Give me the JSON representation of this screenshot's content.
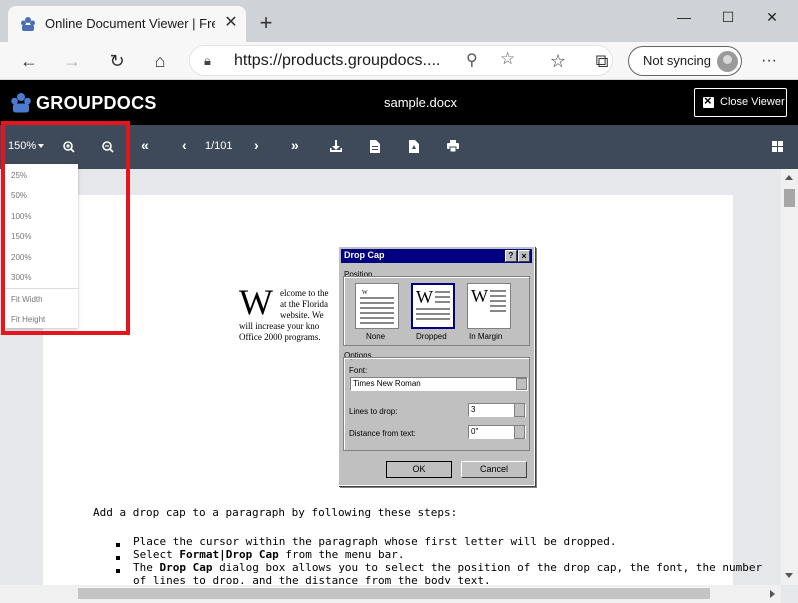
{
  "browser": {
    "tab_title": "Online Document Viewer | Free C",
    "url": "https://products.groupdocs....",
    "sync_label": "Not syncing"
  },
  "app": {
    "logo_text": "GROUPDOCS",
    "file_name": "sample.docx",
    "close_viewer_label": "Close Viewer"
  },
  "toolbar": {
    "zoom_value": "150%",
    "page_indicator": "1/101"
  },
  "zoom_menu": {
    "options": [
      "25%",
      "50%",
      "100%",
      "150%",
      "200%",
      "300%",
      "Fit Width",
      "Fit Height"
    ]
  },
  "document": {
    "drop_letter": "W",
    "para_lines": [
      "elcome to the",
      "at the Florida",
      "website.  We",
      "will increase your kno",
      "Office 2000 programs."
    ],
    "dialog": {
      "title": "Drop Cap",
      "position_label": "Position",
      "positions": [
        "None",
        "Dropped",
        "In Margin"
      ],
      "options_label": "Options",
      "font_label": "Font:",
      "font_value": "Times New Roman",
      "lines_label": "Lines to drop:",
      "lines_value": "3",
      "distance_label": "Distance from text:",
      "distance_value": "0\"",
      "ok_label": "OK",
      "cancel_label": "Cancel"
    },
    "steps_intro": "Add a drop cap to a paragraph by following these steps:",
    "steps": [
      "Place the cursor within the paragraph whose first letter will be dropped.",
      "The Drop Cap dialog box allows you to select the position of the drop cap, the font, the number",
      "of lines to drop, and the distance from the body text."
    ],
    "step2_pre": "Select ",
    "step2_bold": "Format|Drop Cap",
    "step2_post": " from the menu bar.",
    "step3_pre": "The ",
    "step3_bold": "Drop Cap",
    "step3_post": " dialog box allows you to select the position of the drop cap, the font, the number"
  }
}
